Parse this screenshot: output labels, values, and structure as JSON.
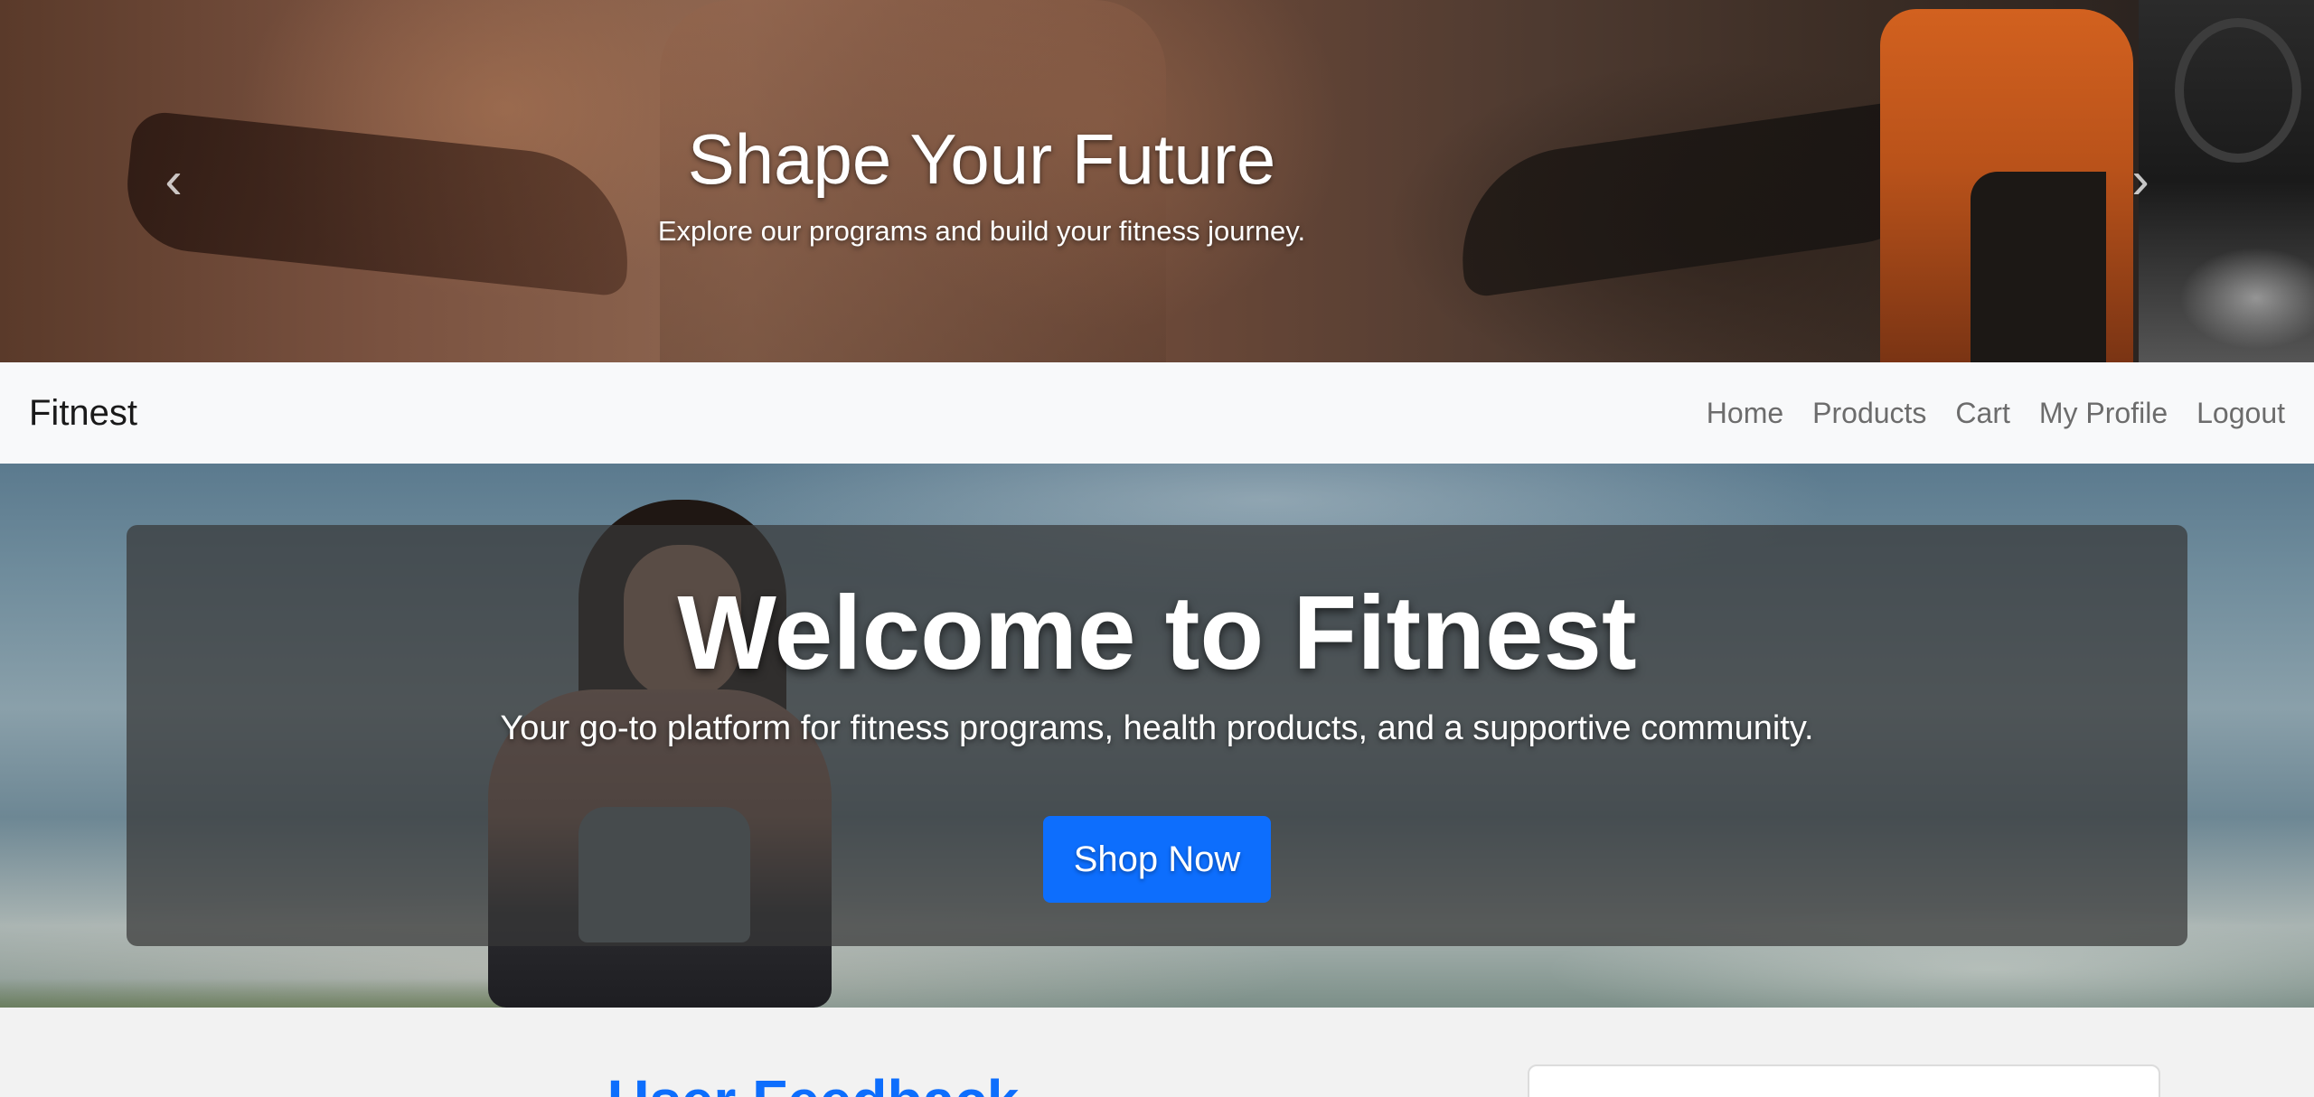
{
  "carousel": {
    "title": "Shape Your Future",
    "subtitle": "Explore our programs and build your fitness journey.",
    "prev_icon": "chevron-left-icon",
    "next_icon": "chevron-right-icon"
  },
  "navbar": {
    "brand": "Fitnest",
    "links": [
      "Home",
      "Products",
      "Cart",
      "My Profile",
      "Logout"
    ]
  },
  "hero": {
    "title": "Welcome to Fitnest",
    "subtitle": "Your go-to platform for fitness programs, health products, and a supportive community.",
    "button_label": "Shop Now"
  },
  "feedback": {
    "title": "User Feedback"
  },
  "colors": {
    "accent": "#0d6efd",
    "navbar_bg": "#f8f9fa",
    "nav_link": "#6c6c6c"
  }
}
